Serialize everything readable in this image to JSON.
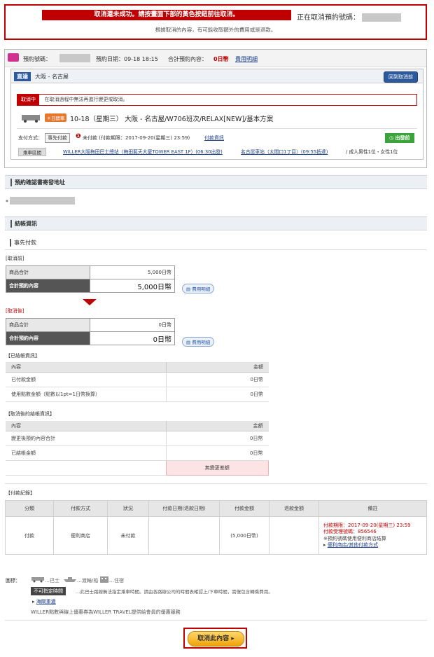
{
  "alert": {
    "error_text": "取消還未成功。請按畫面下部的黃色按鈕前往取消。",
    "cancelling_label": "正在取消預約號碼：",
    "note": "根據取消的內容，有可能收取額外的費用或是退款。"
  },
  "reservation": {
    "number_label": "預約號碼：",
    "date_label": "預約日期：09-18 18:15",
    "total_label": "合計預約內容：",
    "total_value": "0日幣",
    "fee_link": "費用明細",
    "route_tag": "直達",
    "route": "大阪 - 名古屋",
    "back_button": "回到取消前",
    "cancel_tag": "取消中",
    "cancel_msg": "在取消過程中無法再進行變更或取消。",
    "night_tag": "日間車",
    "trip": "10-18（星期三） 大阪 - 名古屋/W706班次/RELAX[NEW]/基本方案",
    "pay_method_label": "支付方式：",
    "pay_method_tag": "事先付款",
    "unpaid_text": "未付款 (付款期限：2017-09-20(星期三) 23:59)",
    "pay_info_link": "付款資訊",
    "depart_button": "出發前",
    "boarding_tag": "乘車區間",
    "boarding_from": "WILLER大阪梅田巴士總站（梅田藍天大廈TOWER EAST 1F）(06:30出發)",
    "boarding_to": "名古屋車站（太閤口1丁目）(09:55抵達)",
    "passengers": "/ 成人男性1位・女性1位"
  },
  "confirm_section": {
    "title": "預約確認書寄發地址",
    "bullet": "*"
  },
  "billing": {
    "title": "結帳資訊",
    "subtitle": "事先付款",
    "before_label": "[取消前]",
    "after_label": "[取消後]",
    "rows_before": {
      "goods_label": "商品合計",
      "goods_value": "5,000日幣",
      "total_label": "合計預約內容",
      "total_value": "5,000日幣"
    },
    "rows_after": {
      "goods_label": "商品合計",
      "goods_value": "0日幣",
      "total_label": "合計預約內容",
      "total_value": "0日幣"
    },
    "fee_button": "費用明細"
  },
  "settled": {
    "title": "【已結帳資訊】",
    "header_content": "內容",
    "header_amount": "金額",
    "rows": [
      {
        "label": "已付款金額",
        "value": "0日幣"
      },
      {
        "label": "使用點數金額（點數以1pt=1日幣換算）",
        "value": "0日幣"
      }
    ]
  },
  "after_settle": {
    "title": "【取消後的結帳資訊】",
    "header_content": "內容",
    "header_amount": "金額",
    "rows": [
      {
        "label": "變更後預約內容合計",
        "value": "0日幣"
      },
      {
        "label": "已結帳金額",
        "value": "0日幣"
      }
    ],
    "no_diff": "無變更差額"
  },
  "payment_record": {
    "title": "【付款紀錄】",
    "headers": [
      "分類",
      "付款方式",
      "狀況",
      "付款日期(退款日期)",
      "付款金額",
      "退款金額",
      "備註"
    ],
    "row": {
      "category": "付款",
      "method": "便利商店",
      "status": "未付款",
      "date": "",
      "amount": "(5,000日幣)",
      "refund": "",
      "note_1": "付款期限：2017-09-20(星期三) 23:59",
      "note_2": "付款受理號碼：856546",
      "note_3": "※預約號碼使用便利商店結算",
      "note_link": "便利商店/其他付款方式"
    }
  },
  "legend": {
    "label": "圖標：",
    "bus": "…巴士",
    "ship": "…渡輪/船",
    "hotel": "…住宿",
    "warn_tag": "不可指定時間",
    "warn_text": "…此巴士路線無法指定乘車時間。請由各路線公司的時間表確認上/下車時間，需復包含轉乘費用。",
    "help_link": "海關重遺",
    "willer_note": "WILLER點數與線上優惠券為WILLER TRAVEL提供給會員的優惠服務"
  },
  "footer": {
    "cancel_button": "取消此內容"
  },
  "colors": {
    "accent_red": "#c00000",
    "brand_blue": "#2d5a9e",
    "button_yellow": "#f0a20a"
  }
}
